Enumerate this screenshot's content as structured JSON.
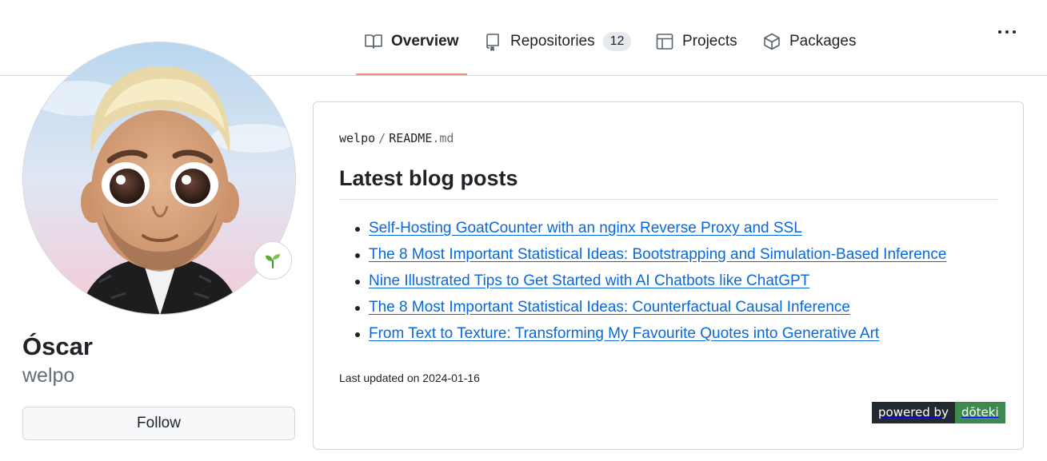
{
  "nav": {
    "tabs": [
      {
        "label": "Overview",
        "icon": "book-icon",
        "active": true
      },
      {
        "label": "Repositories",
        "icon": "repo-icon",
        "count": "12"
      },
      {
        "label": "Projects",
        "icon": "table-icon"
      },
      {
        "label": "Packages",
        "icon": "package-icon"
      }
    ]
  },
  "profile": {
    "full_name": "Óscar",
    "username": "welpo",
    "follow_label": "Follow",
    "status_icon": "seedling-icon"
  },
  "readme": {
    "owner": "welpo",
    "separator": "/",
    "file_base": "README",
    "file_ext": ".md",
    "heading": "Latest blog posts",
    "posts": [
      "Self-Hosting GoatCounter with an nginx Reverse Proxy and SSL",
      "The 8 Most Important Statistical Ideas: Bootstrapping and Simulation-Based Inference",
      "Nine Illustrated Tips to Get Started with AI Chatbots like ChatGPT",
      "The 8 Most Important Statistical Ideas: Counterfactual Causal Inference",
      "From Text to Texture: Transforming My Favourite Quotes into Generative Art"
    ],
    "last_updated": "Last updated on 2024-01-16",
    "powered_by": "powered by",
    "powered_brand": "dōteki"
  },
  "colors": {
    "accent_underline": "#fd8c73",
    "link": "#0969da",
    "badge_dark": "#24292f",
    "badge_green": "#3c8a4e"
  }
}
